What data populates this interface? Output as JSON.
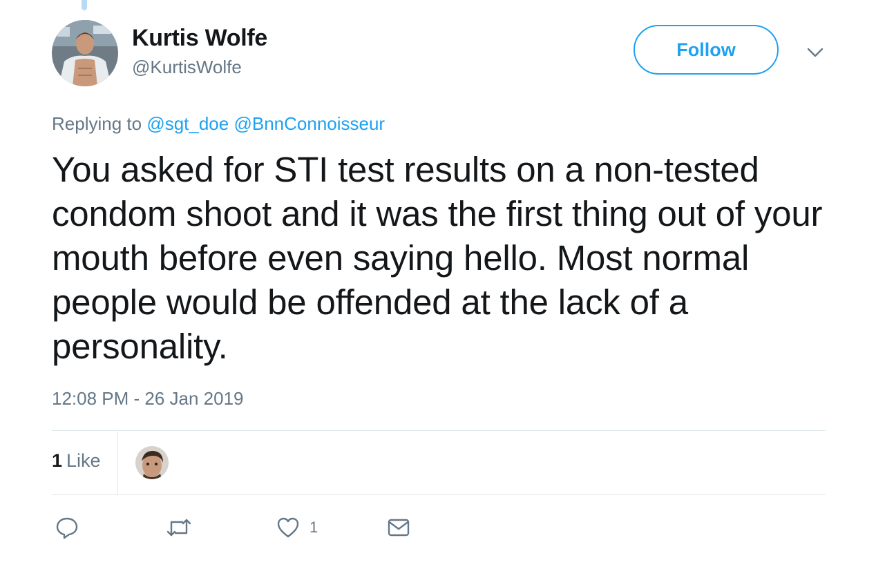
{
  "tweet": {
    "author": {
      "display_name": "Kurtis Wolfe",
      "handle": "@KurtisWolfe"
    },
    "follow_label": "Follow",
    "replying": {
      "prefix": "Replying to",
      "mentions": [
        "@sgt_doe",
        "@BnnConnoisseur"
      ]
    },
    "text": "You asked for STI test results on a non-tested condom shoot and it was the first thing out of your mouth before even saying hello. Most normal people would be offended at the lack of a personality.",
    "timestamp": "12:08 PM - 26 Jan 2019",
    "stats": {
      "likes_count": "1",
      "likes_label": "Like"
    },
    "actions": {
      "like_count": "1"
    }
  },
  "icons": {
    "caret": "chevron-down-icon",
    "reply": "reply-icon",
    "retweet": "retweet-icon",
    "like": "heart-icon",
    "message": "envelope-icon"
  },
  "colors": {
    "accent": "#1da1f2",
    "secondary_text": "#657786",
    "primary_text": "#14171a",
    "divider": "#e1e8ed"
  }
}
